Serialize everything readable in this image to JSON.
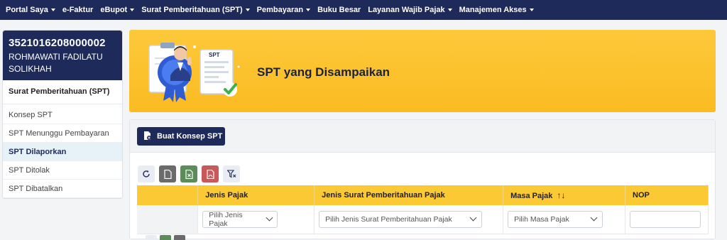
{
  "nav": {
    "items": [
      {
        "label": "Portal Saya",
        "caret": true
      },
      {
        "label": "e-Faktur",
        "caret": false
      },
      {
        "label": "eBupot",
        "caret": true
      },
      {
        "label": "Surat Pemberitahuan (SPT)",
        "caret": true
      },
      {
        "label": "Pembayaran",
        "caret": true
      },
      {
        "label": "Buku Besar",
        "caret": false
      },
      {
        "label": "Layanan Wajib Pajak",
        "caret": true
      },
      {
        "label": "Manajemen Akses",
        "caret": true
      }
    ]
  },
  "user": {
    "npwp": "3521016208000002",
    "name": "ROHMAWATI FADILATU SOLIKHAH"
  },
  "sidebar": {
    "heading": "Surat Pemberitahuan (SPT)",
    "items": [
      {
        "label": "Konsep SPT",
        "active": false
      },
      {
        "label": "SPT Menunggu Pembayaran",
        "active": false
      },
      {
        "label": "SPT Dilaporkan",
        "active": true
      },
      {
        "label": "SPT Ditolak",
        "active": false
      },
      {
        "label": "SPT Dibatalkan",
        "active": false
      }
    ]
  },
  "banner": {
    "title": "SPT yang Disampaikan",
    "doc_label": "SPT"
  },
  "actions": {
    "create_label": "Buat Konsep SPT"
  },
  "table": {
    "columns": [
      "",
      "Jenis Pajak",
      "Jenis Surat Pemberitahuan Pajak",
      "Masa Pajak",
      "NOP"
    ],
    "sort_glyph": "↑↓",
    "filters": {
      "jenis_pajak": "Pilih Jenis Pajak",
      "jenis_spt": "Pilih Jenis Surat Pemberitahuan Pajak",
      "masa_pajak": "Pilih Masa Pajak",
      "nop": ""
    }
  },
  "colors": {
    "navy": "#1e2a5a",
    "accent_yellow": "#fbc934",
    "active_bg": "#e7f1f8"
  },
  "icons": [
    "refresh-icon",
    "file-icon",
    "excel-icon",
    "pdf-icon",
    "filter-clear-icon",
    "document-add-icon"
  ]
}
